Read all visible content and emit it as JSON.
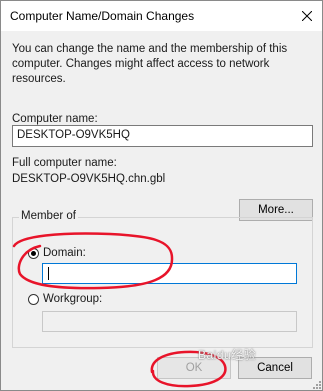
{
  "window": {
    "title": "Computer Name/Domain Changes",
    "close_icon": "close-icon"
  },
  "description": "You can change the name and the membership of this computer. Changes might affect access to network resources.",
  "computer_name": {
    "label": "Computer name:",
    "value": "DESKTOP-O9VK5HQ"
  },
  "full_name": {
    "label": "Full computer name:",
    "value": "DESKTOP-O9VK5HQ.chn.gbl"
  },
  "more_button": "More...",
  "member_of": {
    "legend": "Member of",
    "domain": {
      "label": "Domain:",
      "selected": true,
      "value": ""
    },
    "workgroup": {
      "label": "Workgroup:",
      "selected": false,
      "value": ""
    }
  },
  "buttons": {
    "ok": "OK",
    "cancel": "Cancel"
  },
  "colors": {
    "annotation": "#e8142a",
    "focus_border": "#0078d7"
  },
  "watermark": "Baidu经验"
}
